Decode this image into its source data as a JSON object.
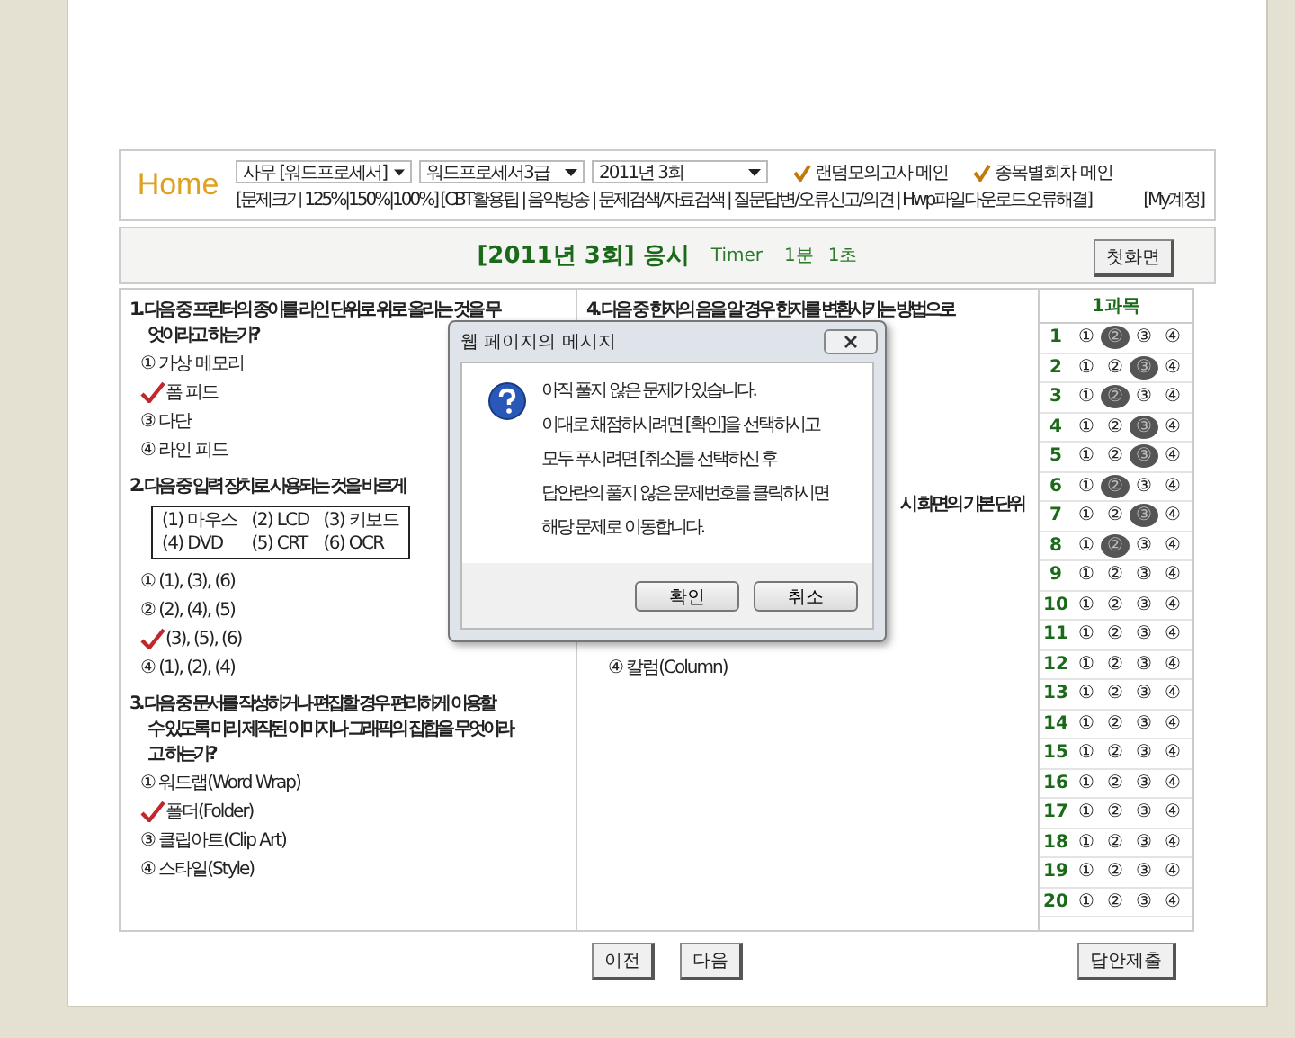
{
  "header": {
    "home": "Home",
    "selects": [
      {
        "value": "사무 [워드프로세서]"
      },
      {
        "value": "워드프로세서3급"
      },
      {
        "value": "2011년 3회"
      }
    ],
    "menus": [
      {
        "label": "랜덤모의고사 메인"
      },
      {
        "label": "종목별회차 메인"
      }
    ],
    "links": "[문제크기 125%|150%|100%] [CBT활용팁 | 음악방송 | 문제검색/자료검색 | 질문답변/오류신고/의견 | Hwp파일다운로드오류해결]",
    "account": "[My계정]"
  },
  "exam_bar": {
    "title": "[2011년 3회] 응시",
    "timer_label": "Timer",
    "minutes": "1분",
    "seconds": "1초",
    "home_button": "첫화면"
  },
  "questions": [
    {
      "lines": [
        "1. 다음 중 프린터의 종이를 라인 단위로 위로 올리는 것을 무",
        "엇이라고 하는가?"
      ],
      "options": [
        {
          "label": "① 가상 메모리",
          "checked": false
        },
        {
          "label": "폼 피드",
          "checked": true
        },
        {
          "label": "③ 다단",
          "checked": false
        },
        {
          "label": "④ 라인 피드",
          "checked": false
        }
      ]
    },
    {
      "lines": [
        "2. 다음 중 입력 장치로 사용되는 것을 바르게"
      ],
      "box": [
        "(1) 마우스",
        "(2) LCD",
        "(3) 키보드",
        "(4) DVD",
        "(5) CRT",
        "(6) OCR"
      ],
      "options": [
        {
          "label": "① (1), (3), (6)",
          "checked": false
        },
        {
          "label": "② (2), (4), (5)",
          "checked": false
        },
        {
          "label": "(3), (5), (6)",
          "checked": true
        },
        {
          "label": "④ (1), (2), (4)",
          "checked": false
        }
      ]
    },
    {
      "lines": [
        "3. 다음 중 문서를 작성하거나 편집할 경우 편리하게 이용할",
        "수 있도록 미리 제작된 이미지나 그래픽의 집합을 무엇이라",
        "고 하는가?"
      ],
      "options": [
        {
          "label": "① 워드랩(Word Wrap)",
          "checked": false
        },
        {
          "label": "폴더(Folder)",
          "checked": true
        },
        {
          "label": "③ 클립아트(Clip Art)",
          "checked": false
        },
        {
          "label": "④ 스타일(Style)",
          "checked": false
        }
      ]
    }
  ],
  "middle": {
    "question": "4. 다음 중 한자의 음을 알 경우 한자를 변환시키는 방법으로",
    "fragment": "시 화면의 기본 단위",
    "option": "④ 칼럼(Column)"
  },
  "answer_sheet": {
    "title": "1과목",
    "rows": [
      {
        "number": "1",
        "choices": [
          {
            "label": "①",
            "selected": false
          },
          {
            "label": "②",
            "selected": true
          },
          {
            "label": "③",
            "selected": false
          },
          {
            "label": "④",
            "selected": false
          }
        ]
      },
      {
        "number": "2",
        "choices": [
          {
            "label": "①",
            "selected": false
          },
          {
            "label": "②",
            "selected": false
          },
          {
            "label": "③",
            "selected": true
          },
          {
            "label": "④",
            "selected": false
          }
        ]
      },
      {
        "number": "3",
        "choices": [
          {
            "label": "①",
            "selected": false
          },
          {
            "label": "②",
            "selected": true
          },
          {
            "label": "③",
            "selected": false
          },
          {
            "label": "④",
            "selected": false
          }
        ]
      },
      {
        "number": "4",
        "choices": [
          {
            "label": "①",
            "selected": false
          },
          {
            "label": "②",
            "selected": false
          },
          {
            "label": "③",
            "selected": true
          },
          {
            "label": "④",
            "selected": false
          }
        ]
      },
      {
        "number": "5",
        "choices": [
          {
            "label": "①",
            "selected": false
          },
          {
            "label": "②",
            "selected": false
          },
          {
            "label": "③",
            "selected": true
          },
          {
            "label": "④",
            "selected": false
          }
        ]
      },
      {
        "number": "6",
        "choices": [
          {
            "label": "①",
            "selected": false
          },
          {
            "label": "②",
            "selected": true
          },
          {
            "label": "③",
            "selected": false
          },
          {
            "label": "④",
            "selected": false
          }
        ]
      },
      {
        "number": "7",
        "choices": [
          {
            "label": "①",
            "selected": false
          },
          {
            "label": "②",
            "selected": false
          },
          {
            "label": "③",
            "selected": true
          },
          {
            "label": "④",
            "selected": false
          }
        ]
      },
      {
        "number": "8",
        "choices": [
          {
            "label": "①",
            "selected": false
          },
          {
            "label": "②",
            "selected": true
          },
          {
            "label": "③",
            "selected": false
          },
          {
            "label": "④",
            "selected": false
          }
        ]
      },
      {
        "number": "9",
        "choices": [
          {
            "label": "①",
            "selected": false
          },
          {
            "label": "②",
            "selected": false
          },
          {
            "label": "③",
            "selected": false
          },
          {
            "label": "④",
            "selected": false
          }
        ]
      },
      {
        "number": "10",
        "choices": [
          {
            "label": "①",
            "selected": false
          },
          {
            "label": "②",
            "selected": false
          },
          {
            "label": "③",
            "selected": false
          },
          {
            "label": "④",
            "selected": false
          }
        ]
      },
      {
        "number": "11",
        "choices": [
          {
            "label": "①",
            "selected": false
          },
          {
            "label": "②",
            "selected": false
          },
          {
            "label": "③",
            "selected": false
          },
          {
            "label": "④",
            "selected": false
          }
        ]
      },
      {
        "number": "12",
        "choices": [
          {
            "label": "①",
            "selected": false
          },
          {
            "label": "②",
            "selected": false
          },
          {
            "label": "③",
            "selected": false
          },
          {
            "label": "④",
            "selected": false
          }
        ]
      },
      {
        "number": "13",
        "choices": [
          {
            "label": "①",
            "selected": false
          },
          {
            "label": "②",
            "selected": false
          },
          {
            "label": "③",
            "selected": false
          },
          {
            "label": "④",
            "selected": false
          }
        ]
      },
      {
        "number": "14",
        "choices": [
          {
            "label": "①",
            "selected": false
          },
          {
            "label": "②",
            "selected": false
          },
          {
            "label": "③",
            "selected": false
          },
          {
            "label": "④",
            "selected": false
          }
        ]
      },
      {
        "number": "15",
        "choices": [
          {
            "label": "①",
            "selected": false
          },
          {
            "label": "②",
            "selected": false
          },
          {
            "label": "③",
            "selected": false
          },
          {
            "label": "④",
            "selected": false
          }
        ]
      },
      {
        "number": "16",
        "choices": [
          {
            "label": "①",
            "selected": false
          },
          {
            "label": "②",
            "selected": false
          },
          {
            "label": "③",
            "selected": false
          },
          {
            "label": "④",
            "selected": false
          }
        ]
      },
      {
        "number": "17",
        "choices": [
          {
            "label": "①",
            "selected": false
          },
          {
            "label": "②",
            "selected": false
          },
          {
            "label": "③",
            "selected": false
          },
          {
            "label": "④",
            "selected": false
          }
        ]
      },
      {
        "number": "18",
        "choices": [
          {
            "label": "①",
            "selected": false
          },
          {
            "label": "②",
            "selected": false
          },
          {
            "label": "③",
            "selected": false
          },
          {
            "label": "④",
            "selected": false
          }
        ]
      },
      {
        "number": "19",
        "choices": [
          {
            "label": "①",
            "selected": false
          },
          {
            "label": "②",
            "selected": false
          },
          {
            "label": "③",
            "selected": false
          },
          {
            "label": "④",
            "selected": false
          }
        ]
      },
      {
        "number": "20",
        "choices": [
          {
            "label": "①",
            "selected": false
          },
          {
            "label": "②",
            "selected": false
          },
          {
            "label": "③",
            "selected": false
          },
          {
            "label": "④",
            "selected": false
          }
        ]
      }
    ]
  },
  "nav_buttons": [
    "이전",
    "다음"
  ],
  "submit_button": "답안제출",
  "dialog": {
    "title": "웹 페이지의 메시지",
    "lines": [
      "아직 풀지 않은 문제가 있습니다.",
      "이대로 채점하시려면 [확인]을 선택하시고",
      "모두 푸시려면 [취소]를 선택하신 후",
      "답안란의 풀지 않은 문제번호를 클릭하시면",
      "해당 문제로 이동합니다."
    ],
    "buttons": [
      "확인",
      "취소"
    ]
  }
}
